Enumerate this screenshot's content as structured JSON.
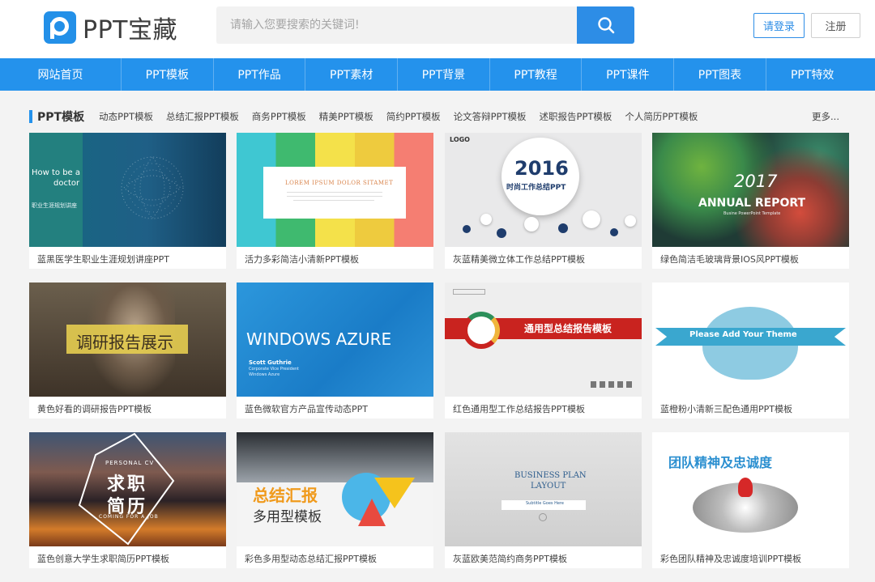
{
  "header": {
    "logo_text": "PPT宝藏",
    "search_placeholder": "请输入您要搜索的关键词!",
    "login_label": "请登录",
    "register_label": "注册"
  },
  "nav": {
    "items": [
      "网站首页",
      "PPT模板",
      "PPT作品",
      "PPT素材",
      "PPT背景",
      "PPT教程",
      "PPT课件",
      "PPT图表",
      "PPT特效"
    ]
  },
  "category": {
    "title": "PPT模板",
    "links": [
      "动态PPT模板",
      "总结汇报PPT模板",
      "商务PPT模板",
      "精美PPT模板",
      "简约PPT模板",
      "论文答辩PPT模板",
      "述职报告PPT模板",
      "个人简历PPT模板"
    ],
    "more": "更多..."
  },
  "cards": [
    {
      "title": "蓝黑医学生职业生涯规划讲座PPT",
      "thumb_text": [
        "How to be a",
        "doctor",
        "职业生涯规划讲座"
      ]
    },
    {
      "title": "活力多彩简洁小清新PPT模板",
      "thumb_text": [
        "LOREM IPSUM DOLOR SITAMET"
      ]
    },
    {
      "title": "灰蓝精美微立体工作总结PPT模板",
      "thumb_text": [
        "LOGO",
        "2016",
        "时尚工作总结PPT"
      ]
    },
    {
      "title": "绿色简洁毛玻璃背景IOS风PPT模板",
      "thumb_text": [
        "2017",
        "ANNUAL REPORT",
        "Busine PowerPoint Template"
      ]
    },
    {
      "title": "黄色好看的调研报告PPT模板",
      "thumb_text": [
        "调研报告展示"
      ]
    },
    {
      "title": "蓝色微软官方产品宣传动态PPT",
      "thumb_text": [
        "WINDOWS AZURE",
        "Scott Guthrie",
        "Corporate Vice President",
        "Windows Azure"
      ]
    },
    {
      "title": "红色通用型工作总结报告PPT模板",
      "thumb_text": [
        "通用型总结报告模板"
      ]
    },
    {
      "title": "蓝橙粉小清新三配色通用PPT模板",
      "thumb_text": [
        "Please Add Your Theme"
      ]
    },
    {
      "title": "蓝色创意大学生求职简历PPT模板",
      "thumb_text": [
        "PERSONAL CV",
        "求职",
        "简历",
        "COMING FOR A JOB"
      ]
    },
    {
      "title": "彩色多用型动态总结汇报PPT模板",
      "thumb_text": [
        "总结汇报",
        "多用型模板"
      ]
    },
    {
      "title": "灰蓝欧美范简约商务PPT模板",
      "thumb_text": [
        "BUSINESS PLAN",
        "LAYOUT",
        "Subtitle Goes Here"
      ]
    },
    {
      "title": "彩色团队精神及忠诚度培训PPT模板",
      "thumb_text": [
        "团队精神及忠诚度"
      ]
    }
  ],
  "colors": {
    "brand_blue": "#2492ec",
    "search_button": "#2d8de6",
    "page_bg": "#f3f3f3"
  }
}
